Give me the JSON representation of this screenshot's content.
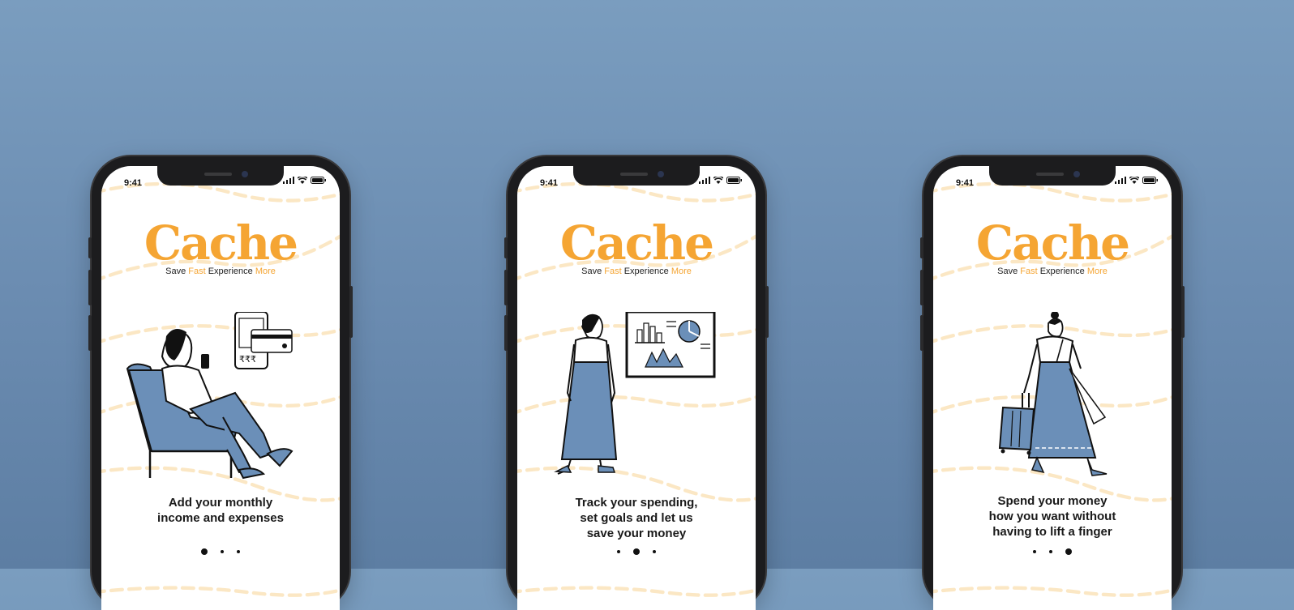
{
  "status_time": "9:41",
  "brand": {
    "name": "Cache",
    "tagline": [
      "Save",
      "Fast",
      "Experience",
      "More"
    ],
    "color": "#f5a533"
  },
  "accent_blue": "#6b8fb8",
  "screens": [
    {
      "caption": [
        "Add your monthly",
        "income and expenses"
      ],
      "active_dot": 0
    },
    {
      "caption": [
        "Track your spending,",
        "set goals and let us",
        "save your money"
      ],
      "active_dot": 1
    },
    {
      "caption": [
        "Spend your money",
        "how you want without",
        "having to lift a finger"
      ],
      "active_dot": 2
    }
  ],
  "illustration_text": {
    "rupees": "₹₹₹"
  },
  "icons": [
    "signal-icon",
    "wifi-icon",
    "battery-icon"
  ]
}
